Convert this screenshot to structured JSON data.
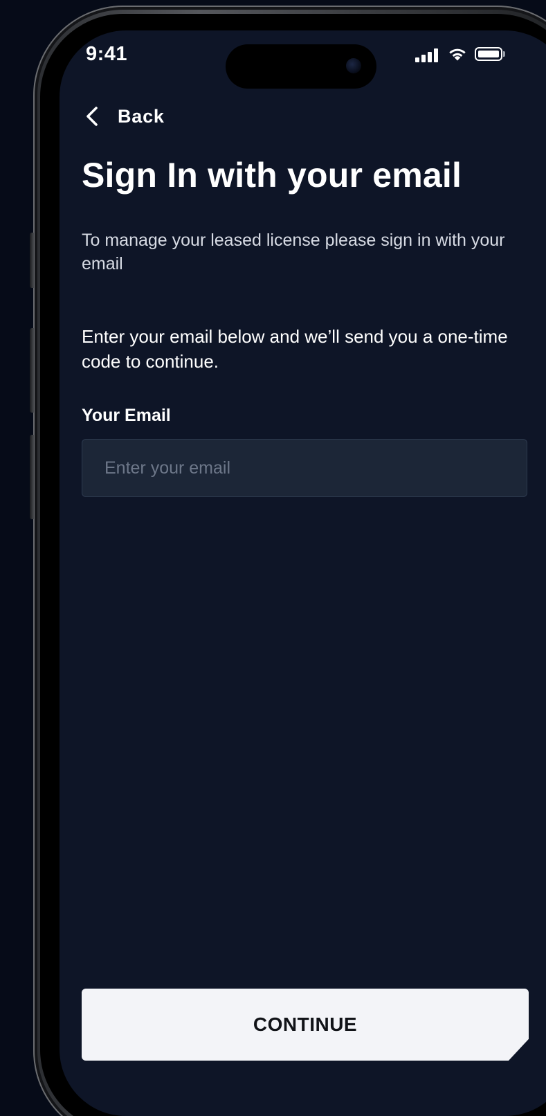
{
  "status_bar": {
    "time": "9:41",
    "signal_icon": "cellular-signal-icon",
    "wifi_icon": "wifi-icon",
    "battery_icon": "battery-icon"
  },
  "nav": {
    "back_label": "Back",
    "back_icon": "chevron-left-icon"
  },
  "page": {
    "title": "Sign In with your email",
    "intro": "To manage your leased license please sign in with your email",
    "instructions": "Enter your email below and we’ll send you a one-time code to continue."
  },
  "form": {
    "email_label": "Your Email",
    "email_placeholder": "Enter your email",
    "email_value": ""
  },
  "actions": {
    "continue_label": "CONTINUE"
  },
  "colors": {
    "background": "#060b18",
    "screen": "#0e1527",
    "input_bg": "#1c2637",
    "input_border": "#2d3a4e",
    "button_bg": "#f3f4f8",
    "text_primary": "#ffffff"
  }
}
